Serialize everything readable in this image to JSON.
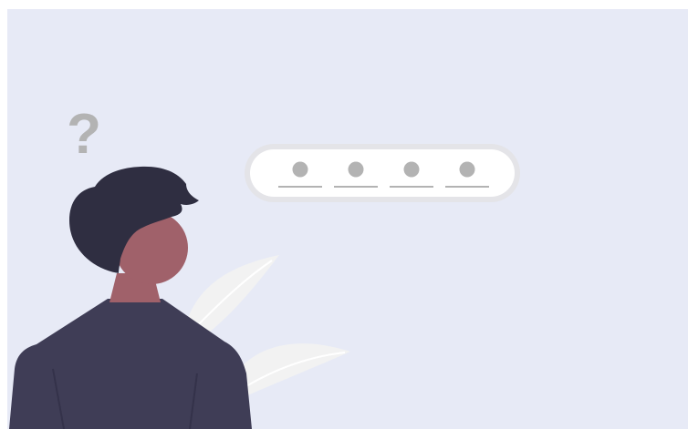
{
  "colors": {
    "background": "#e7eaf6",
    "pill_outer": "#e4e4e8",
    "pill_inner": "#ffffff",
    "pin_dot": "#b3b3b3",
    "pin_line": "#b3b3b3",
    "hair": "#2f2e41",
    "face": "#a0616a",
    "body": "#3f3d56",
    "leaf": "#f2f2f2",
    "leaf_vein": "#ffffff",
    "question_mark": "#b3b3b3"
  },
  "illustration": {
    "pin_field_count": 4,
    "question_mark_glyph": "?"
  }
}
